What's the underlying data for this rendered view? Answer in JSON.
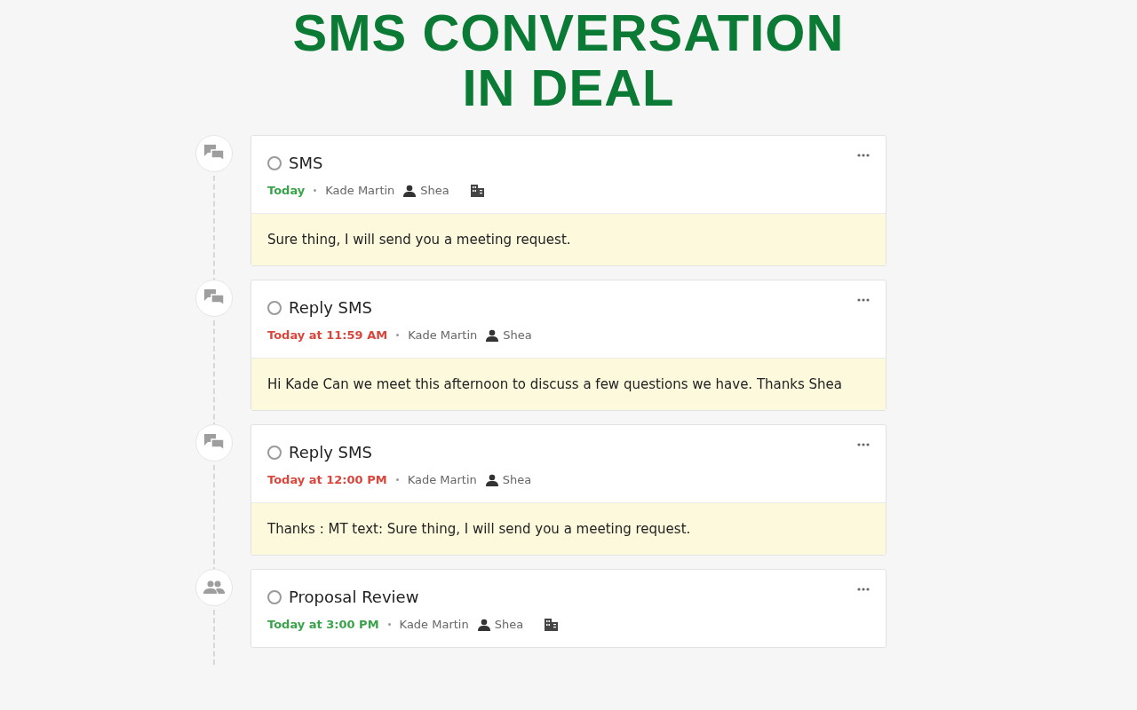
{
  "title": [
    "SMS CONVERSATION",
    "IN DEAL"
  ],
  "activities": [
    {
      "kind": "sms",
      "title": "SMS",
      "checked": false,
      "date": "Today",
      "overdue": false,
      "owner": "Kade Martin",
      "contact": "Shea",
      "organization": true,
      "note": "Sure thing, I will send you a meeting request."
    },
    {
      "kind": "sms",
      "title": "Reply SMS",
      "checked": false,
      "date": "Today at 11:59 AM",
      "overdue": true,
      "owner": "Kade Martin",
      "contact": "Shea",
      "organization": false,
      "note": "Hi Kade Can we meet this afternoon to discuss a few questions we have. Thanks Shea"
    },
    {
      "kind": "sms",
      "title": "Reply SMS",
      "checked": false,
      "date": "Today at 12:00 PM",
      "overdue": true,
      "owner": "Kade Martin",
      "contact": "Shea",
      "organization": false,
      "note": "Thanks : MT text: Sure thing, I will send you a meeting request."
    },
    {
      "kind": "meeting",
      "title": "Proposal Review",
      "checked": false,
      "date": "Today at 3:00 PM",
      "overdue": false,
      "owner": "Kade Martin",
      "contact": "Shea",
      "organization": true
    }
  ]
}
